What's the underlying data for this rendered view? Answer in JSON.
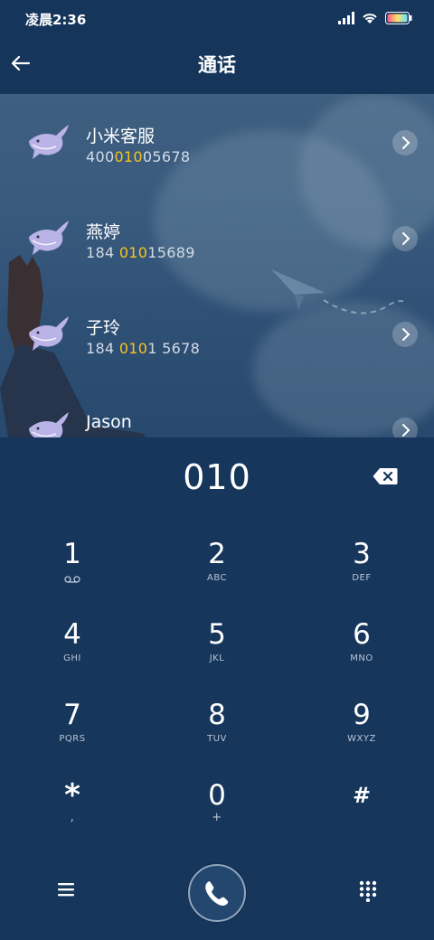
{
  "status_bar": {
    "time": "凌晨2:36",
    "icons": [
      "signal-icon",
      "wifi-icon",
      "battery-icon"
    ]
  },
  "header": {
    "title": "通话",
    "back_icon": "back-arrow-icon"
  },
  "contacts": [
    {
      "name": "小米客服",
      "number_pre": "400",
      "number_hl": "010",
      "number_post": "05678"
    },
    {
      "name": "燕婷",
      "number_pre": "184 ",
      "number_hl": "010",
      "number_post": "15689"
    },
    {
      "name": "子玲",
      "number_pre": "184 ",
      "number_hl": "010",
      "number_post": "1 5678"
    },
    {
      "name": "Jason",
      "number_pre": "",
      "number_hl": "",
      "number_post": ""
    }
  ],
  "dialer": {
    "entered": "010",
    "keys": [
      {
        "digit": "1",
        "letters": "voicemail"
      },
      {
        "digit": "2",
        "letters": "ABC"
      },
      {
        "digit": "3",
        "letters": "DEF"
      },
      {
        "digit": "4",
        "letters": "GHI"
      },
      {
        "digit": "5",
        "letters": "JKL"
      },
      {
        "digit": "6",
        "letters": "MNO"
      },
      {
        "digit": "7",
        "letters": "PQRS"
      },
      {
        "digit": "8",
        "letters": "TUV"
      },
      {
        "digit": "9",
        "letters": "WXYZ"
      },
      {
        "digit": "*",
        "letters": ","
      },
      {
        "digit": "0",
        "letters": "+"
      },
      {
        "digit": "#",
        "letters": ""
      }
    ]
  },
  "colors": {
    "background": "#16365c",
    "highlight": "#f7c51c"
  }
}
